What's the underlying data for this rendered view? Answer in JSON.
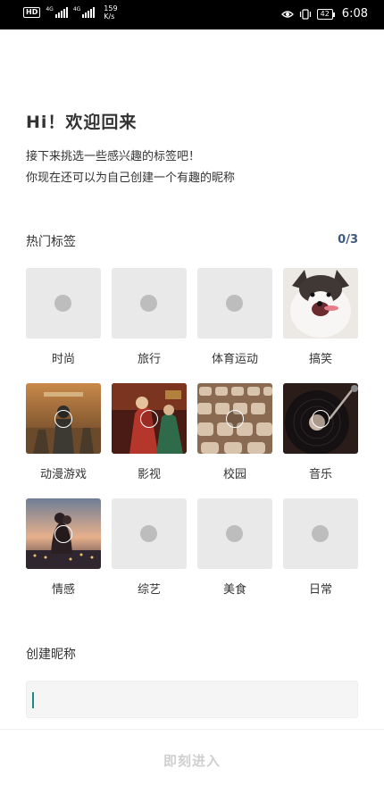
{
  "status_bar": {
    "hd": "HD",
    "net1": "4G",
    "net2": "4G",
    "speed_value": "159",
    "speed_unit": "K/s",
    "battery": "42",
    "time": "6:08"
  },
  "header": {
    "greeting": "Hi！欢迎回来",
    "line1": "接下来挑选一些感兴趣的标签吧！",
    "line2": "你现在还可以为自己创建一个有趣的昵称"
  },
  "hot_tags": {
    "label": "热门标签",
    "counter": "0/3",
    "tags": [
      {
        "label": "时尚",
        "image": "placeholder"
      },
      {
        "label": "旅行",
        "image": "placeholder"
      },
      {
        "label": "体育运动",
        "image": "placeholder"
      },
      {
        "label": "搞笑",
        "image": "husky-dog-photo"
      },
      {
        "label": "动漫游戏",
        "image": "battle-game-photo"
      },
      {
        "label": "影视",
        "image": "drama-costume-photo"
      },
      {
        "label": "校园",
        "image": "auditorium-seats-photo"
      },
      {
        "label": "音乐",
        "image": "vinyl-record-photo"
      },
      {
        "label": "情感",
        "image": "couple-sunset-photo"
      },
      {
        "label": "综艺",
        "image": "placeholder"
      },
      {
        "label": "美食",
        "image": "placeholder"
      },
      {
        "label": "日常",
        "image": "placeholder"
      }
    ]
  },
  "nickname": {
    "label": "创建昵称",
    "value": "",
    "placeholder": ""
  },
  "footer": {
    "submit_label": "即刻进入"
  },
  "colors": {
    "accent_counter": "#3d5a80",
    "caret": "#1a8a86",
    "placeholder_bg": "#e9e9e9",
    "disabled_text": "#cfcfcf"
  }
}
